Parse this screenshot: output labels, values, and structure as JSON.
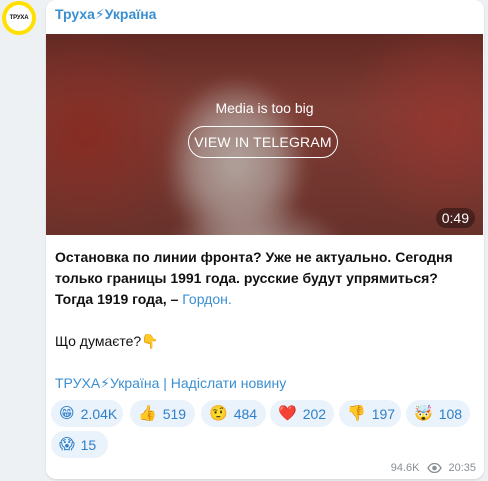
{
  "channel": {
    "name": "Труха⚡Україна",
    "avatar_text": "ТРУХА"
  },
  "media": {
    "message": "Media is too big",
    "button_label": "VIEW IN TELEGRAM",
    "duration": "0:49"
  },
  "post": {
    "bold_text": "Остановка по линии фронта? Уже не актуально. Сегодня только границы 1991 года. русские будут упрямиться? Тогда 1919 года, –",
    "source_link": "Гордон.",
    "question": "Що думаєте?",
    "question_emoji": "👇",
    "footer_channel": "ТРУХА⚡Україна",
    "footer_separator": " | ",
    "footer_submit": "Надіслати новину"
  },
  "reactions": [
    {
      "emoji": "😁",
      "count": "2.04K"
    },
    {
      "emoji": "👍",
      "count": "519"
    },
    {
      "emoji": "🤨",
      "count": "484"
    },
    {
      "emoji": "❤️",
      "count": "202"
    },
    {
      "emoji": "👎",
      "count": "197"
    },
    {
      "emoji": "🤯",
      "count": "108"
    },
    {
      "emoji": "😱",
      "count": "15"
    }
  ],
  "meta": {
    "views": "94.6K",
    "time": "20:35"
  },
  "colors": {
    "accent": "#3a8fd0",
    "reaction_bg": "#eaf2fb",
    "avatar_ring": "#ffe000"
  }
}
